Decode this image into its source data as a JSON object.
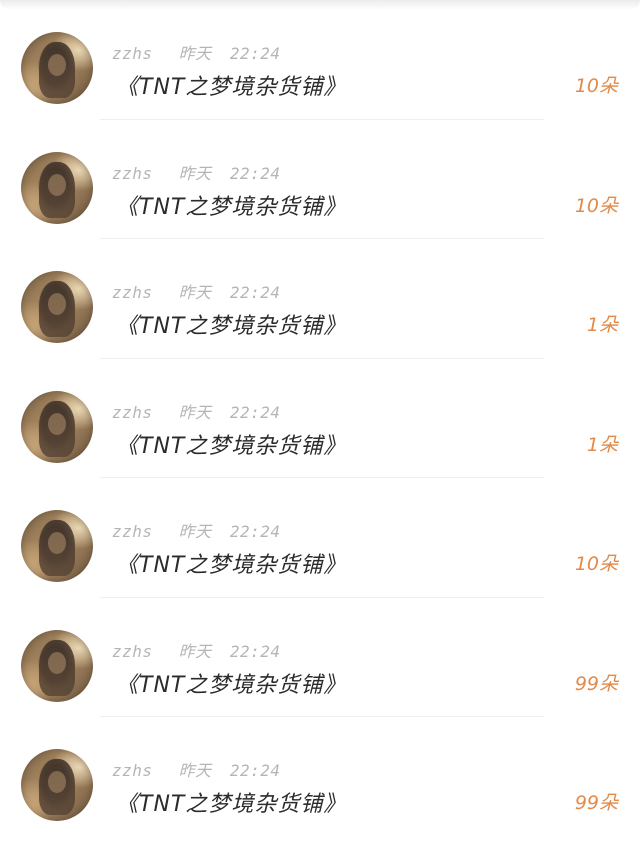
{
  "gift_list": {
    "items": [
      {
        "username": "zzhs",
        "date": "昨天",
        "time": "22:24",
        "title": "《TNT之梦境杂货铺》",
        "amount": "10朵"
      },
      {
        "username": "zzhs",
        "date": "昨天",
        "time": "22:24",
        "title": "《TNT之梦境杂货铺》",
        "amount": "10朵"
      },
      {
        "username": "zzhs",
        "date": "昨天",
        "time": "22:24",
        "title": "《TNT之梦境杂货铺》",
        "amount": "1朵"
      },
      {
        "username": "zzhs",
        "date": "昨天",
        "time": "22:24",
        "title": "《TNT之梦境杂货铺》",
        "amount": "1朵"
      },
      {
        "username": "zzhs",
        "date": "昨天",
        "time": "22:24",
        "title": "《TNT之梦境杂货铺》",
        "amount": "10朵"
      },
      {
        "username": "zzhs",
        "date": "昨天",
        "time": "22:24",
        "title": "《TNT之梦境杂货铺》",
        "amount": "99朵"
      },
      {
        "username": "zzhs",
        "date": "昨天",
        "time": "22:24",
        "title": "《TNT之梦境杂货铺》",
        "amount": "99朵"
      }
    ]
  },
  "colors": {
    "amount": "#e28a4a",
    "meta": "#b5b5b5",
    "title": "#2b2b2b"
  }
}
